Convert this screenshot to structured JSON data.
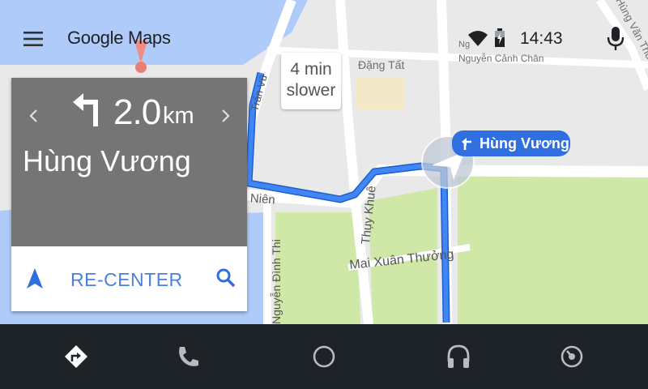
{
  "app": {
    "title": "Google Maps"
  },
  "status": {
    "time": "14:43"
  },
  "navigation": {
    "distance_value": "2.0",
    "distance_unit": "km",
    "street": "Hùng Vương",
    "recenter_label": "RE-CENTER"
  },
  "traffic_bubble": {
    "line1": "4 min",
    "line2": "slower"
  },
  "turn_chip": {
    "label": "Hùng Vương"
  },
  "map_labels": {
    "dang_tat": "Đặng Tất",
    "nguyen_canh_chan": "Nguyễn Cảnh Chân",
    "mai_xuan_thuong": "Mai Xuân Thưởng",
    "thuy_khue": "Thụy Khuê",
    "nguyen_dinh_thi": "Nguyễn Đình Thi",
    "thanh_nien": "Thanh Niên",
    "tran_vu": "Trấn Vũ",
    "hung_van_thu": "Hùng Văn Thu",
    "ng": "Ng"
  },
  "colors": {
    "route": "#4285f4",
    "card_top": "#757575",
    "accent": "#4a7fe0",
    "bar": "#1e2327",
    "water": "#aecbfa",
    "park": "#c8e6a0"
  },
  "icons": [
    "menu-icon",
    "wifi-icon",
    "battery-icon",
    "microphone-icon",
    "turn-left-icon",
    "chevron-left-icon",
    "chevron-right-icon",
    "navigation-arrow-icon",
    "search-icon",
    "directions-icon",
    "phone-icon",
    "home-circle-icon",
    "headphones-icon",
    "car-status-icon"
  ]
}
